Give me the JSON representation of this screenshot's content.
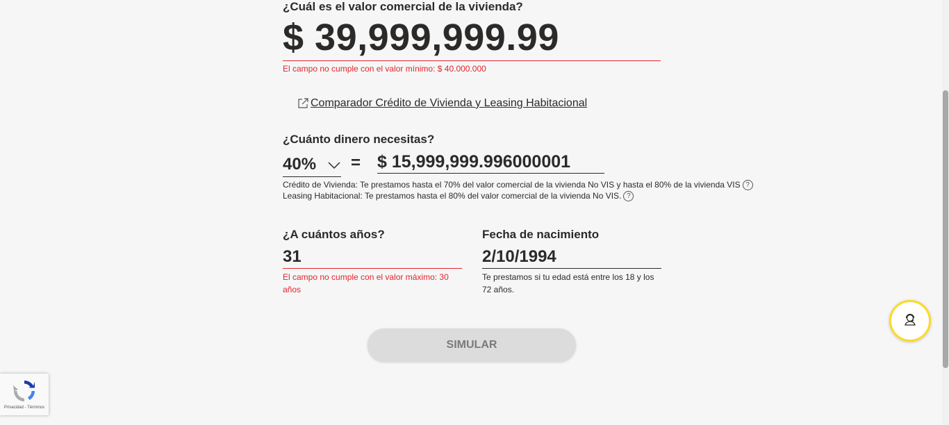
{
  "form": {
    "property_value": {
      "label": "¿Cuál es el valor comercial de la vivienda?",
      "value": "$ 39,999,999.99",
      "error": "El campo no cumple con el valor mínimo: $ 40.000.000"
    },
    "comparator_link": "Comparador Crédito de Vivienda y Leasing Habitacional",
    "amount": {
      "label": "¿Cuánto dinero necesitas?",
      "percent": "40%",
      "equals": "=",
      "value": "$ 15,999,999.996000001",
      "credit_note": "Crédito de Vivienda: Te prestamos hasta el 70% del valor comercial de la vivienda No VIS y hasta el 80% de la vivienda VIS",
      "leasing_note": "Leasing Habitacional: Te prestamos hasta el 80% del valor comercial de la vivienda No VIS."
    },
    "years": {
      "label": "¿A cuántos años?",
      "value": "31",
      "error": "El campo no cumple con el valor máximo: 30 años"
    },
    "birth_date": {
      "label": "Fecha de nacimiento",
      "value": "2/10/1994",
      "hint": "Te prestamos si tu edad está entre los 18 y los 72 años."
    },
    "simulate_button": "SIMULAR"
  },
  "recaptcha": {
    "links": "Privacidad - Términos"
  },
  "icons": {
    "external_link": "external-link-icon",
    "chevron": "chevron-down-icon",
    "help": "help-icon",
    "assistant": "assistant-icon",
    "recaptcha": "recaptcha-logo-icon"
  },
  "colors": {
    "error": "#e3242b",
    "accent_yellow": "#fdda24",
    "text": "#2c2a29",
    "button_disabled": "#dcdcdc"
  }
}
